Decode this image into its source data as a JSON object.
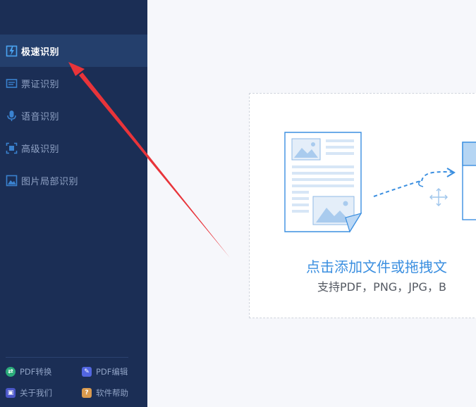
{
  "sidebar": {
    "items": [
      {
        "label": "极速识别",
        "icon": "fast-recognize-icon",
        "active": true
      },
      {
        "label": "票证识别",
        "icon": "ticket-icon",
        "active": false
      },
      {
        "label": "语音识别",
        "icon": "microphone-icon",
        "active": false
      },
      {
        "label": "高级识别",
        "icon": "scan-frame-icon",
        "active": false
      },
      {
        "label": "图片局部识别",
        "icon": "image-crop-icon",
        "active": false
      }
    ],
    "footer": [
      {
        "label": "PDF转换",
        "icon": "pdf-convert-icon",
        "color": "#2bab7a"
      },
      {
        "label": "PDF编辑",
        "icon": "pdf-edit-icon",
        "color": "#5266e0"
      },
      {
        "label": "关于我们",
        "icon": "about-icon",
        "color": "#4a56c8"
      },
      {
        "label": "软件帮助",
        "icon": "help-icon",
        "color": "#d99a4e"
      }
    ]
  },
  "main": {
    "drop_title": "点击添加文件或拖拽文",
    "drop_subtitle": "支持PDF，PNG，JPG，B"
  },
  "colors": {
    "sidebar_bg": "#1b2e55",
    "active_bg": "#243f6c",
    "accent": "#3b8fe0",
    "annotation_arrow": "#e8343a"
  }
}
